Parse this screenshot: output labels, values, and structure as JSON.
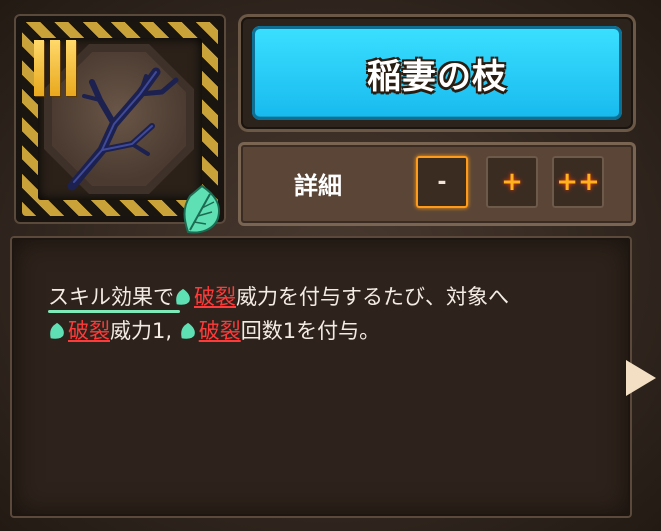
{
  "card": {
    "name": "稲妻の枝",
    "rank_numeral": "III",
    "icons": {
      "item": "lightning-branch-icon",
      "element": "green-leaf-icon"
    }
  },
  "detail": {
    "label": "詳細",
    "buttons": {
      "minus": "-",
      "plus": "+",
      "plusplus": "++"
    }
  },
  "description": {
    "prefix": "スキル効果で",
    "kw1": "破裂",
    "part1": "威力を付与するたび、対象へ",
    "kw2": "破裂",
    "part2": "威力1, ",
    "kw3": "破裂",
    "part3": "回数1を付与。"
  },
  "colors": {
    "title_bg": "#17b9ee",
    "keyword": "#ff3a3a",
    "accent_orange": "#ff9b18",
    "leaf": "#5fe0b4"
  }
}
